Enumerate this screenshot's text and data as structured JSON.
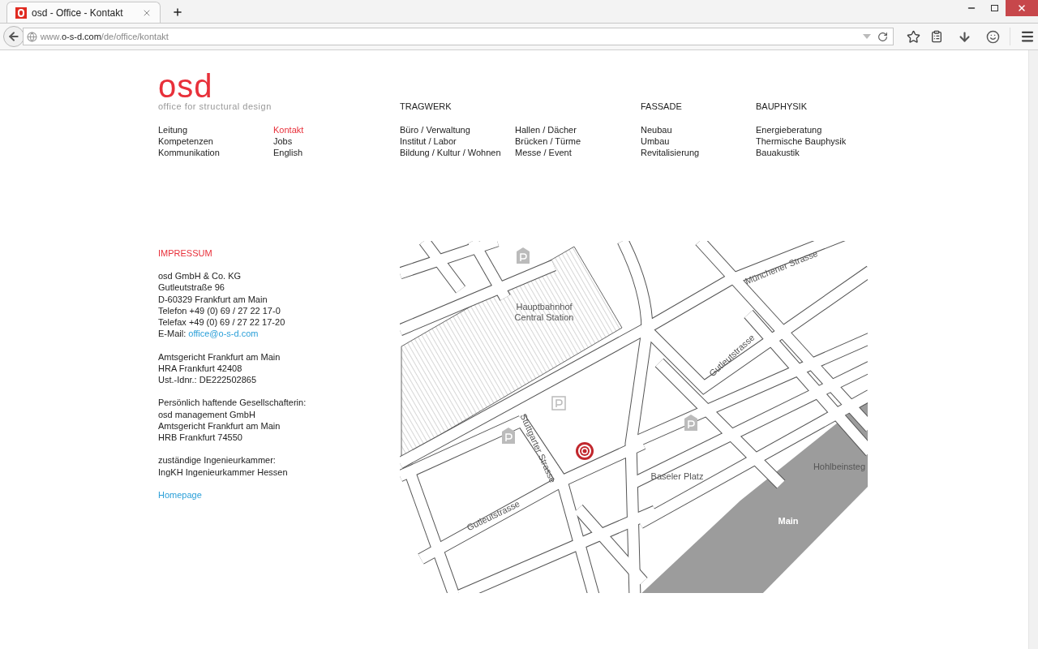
{
  "browser": {
    "tab": {
      "title": "osd - Office - Kontakt",
      "selected": true
    },
    "url": {
      "prefix": "www.",
      "domain": "o-s-d.com",
      "path": "/de/office/kontakt"
    }
  },
  "logo": {
    "wordmark": "osd",
    "tagline": "office for structural design"
  },
  "nav": [
    {
      "columns": [
        [
          {
            "label": "Leitung",
            "selected": false
          },
          {
            "label": "Kompetenzen",
            "selected": false
          },
          {
            "label": "Kommunikation",
            "selected": false
          }
        ],
        [
          {
            "label": "Kontakt",
            "selected": true
          },
          {
            "label": "Jobs",
            "selected": false
          },
          {
            "label": "English",
            "selected": false
          }
        ]
      ]
    },
    {
      "heading": "TRAGWERK",
      "columns": [
        [
          {
            "label": "Büro / Verwaltung",
            "selected": false
          },
          {
            "label": "Institut / Labor",
            "selected": false
          },
          {
            "label": "Bildung / Kultur / Wohnen",
            "selected": false
          }
        ],
        [
          {
            "label": "Hallen / Dächer",
            "selected": false
          },
          {
            "label": "Brücken / Türme",
            "selected": false
          },
          {
            "label": "Messe / Event",
            "selected": false
          }
        ]
      ]
    },
    {
      "heading": "FASSADE",
      "columns": [
        [
          {
            "label": "Neubau",
            "selected": false
          },
          {
            "label": "Umbau",
            "selected": false
          },
          {
            "label": "Revitalisierung",
            "selected": false
          }
        ]
      ]
    },
    {
      "heading": "BAUPHYSIK",
      "columns": [
        [
          {
            "label": "Energieberatung",
            "selected": false
          },
          {
            "label": "Thermische Bauphysik",
            "selected": false
          },
          {
            "label": "Bauakustik",
            "selected": false
          }
        ]
      ]
    }
  ],
  "impressum": {
    "title": "IMPRESSUM",
    "paragraphs": [
      [
        {
          "text": "osd GmbH & Co. KG"
        },
        {
          "text": "Gutleutstraße 96"
        },
        {
          "text": "D-60329 Frankfurt am Main"
        },
        {
          "text": "Telefon +49 (0) 69 / 27 22 17-0"
        },
        {
          "text": "Telefax +49 (0) 69 / 27 22 17-20"
        },
        {
          "text": "E-Mail: ",
          "link": "office@o-s-d.com"
        }
      ],
      [
        {
          "text": "Amtsgericht Frankfurt am Main"
        },
        {
          "text": "HRA Frankfurt 42408"
        },
        {
          "text": "Ust.-Idnr.: DE222502865"
        }
      ],
      [
        {
          "text": "Persönlich haftende Gesellschafterin:"
        },
        {
          "text": "osd management GmbH"
        },
        {
          "text": "Amtsgericht Frankfurt am Main"
        },
        {
          "text": "HRB Frankfurt 74550"
        }
      ],
      [
        {
          "text": "zuständige Ingenieurkammer:"
        },
        {
          "text": "IngKH Ingenieurkammer Hessen"
        }
      ]
    ],
    "homepage_link": "Homepage"
  },
  "map": {
    "labels": [
      {
        "text": "Hauptbahnhof",
        "kind": "place"
      },
      {
        "text": "Central Station",
        "kind": "place"
      },
      {
        "text": "Münchener Strasse",
        "kind": "street"
      },
      {
        "text": "Gutleutstrasse",
        "kind": "street"
      },
      {
        "text": "Stuttgarter Strasse",
        "kind": "street"
      },
      {
        "text": "Baseler Platz",
        "kind": "place"
      },
      {
        "text": "Gutleutstrasse",
        "kind": "street"
      },
      {
        "text": "Hohlbeinsteg",
        "kind": "place"
      },
      {
        "text": "Main",
        "kind": "water"
      }
    ]
  }
}
